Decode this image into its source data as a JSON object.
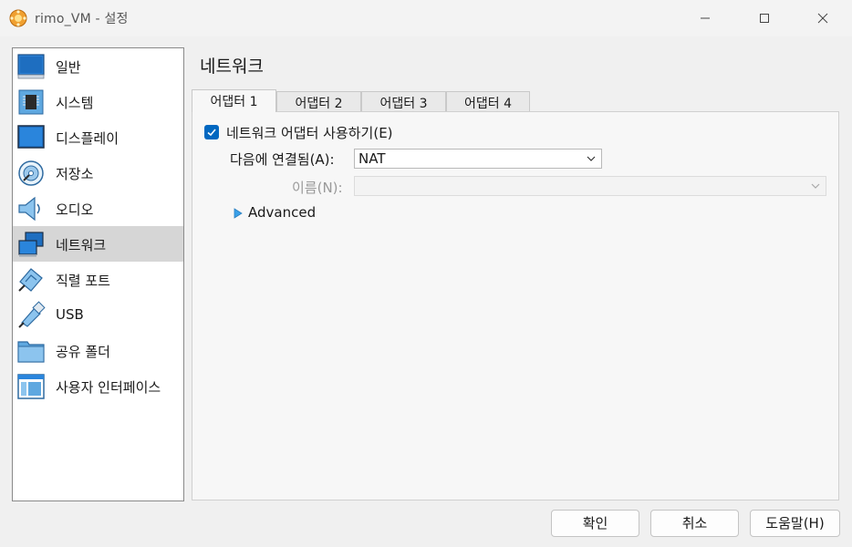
{
  "window": {
    "title": "rimo_VM - 설정"
  },
  "sidebar": {
    "items": [
      {
        "label": "일반",
        "icon": "general-icon"
      },
      {
        "label": "시스템",
        "icon": "system-chip-icon"
      },
      {
        "label": "디스플레이",
        "icon": "display-icon"
      },
      {
        "label": "저장소",
        "icon": "storage-disk-icon"
      },
      {
        "label": "오디오",
        "icon": "audio-speaker-icon"
      },
      {
        "label": "네트워크",
        "icon": "network-icon",
        "selected": true
      },
      {
        "label": "직렬 포트",
        "icon": "serial-port-icon"
      },
      {
        "label": "USB",
        "icon": "usb-icon"
      },
      {
        "label": "공유 폴더",
        "icon": "shared-folder-icon"
      },
      {
        "label": "사용자 인터페이스",
        "icon": "user-interface-icon"
      }
    ]
  },
  "page": {
    "title": "네트워크"
  },
  "tabs": [
    {
      "label": "어댑터 1",
      "active": true
    },
    {
      "label": "어댑터 2",
      "active": false
    },
    {
      "label": "어댑터 3",
      "active": false
    },
    {
      "label": "어댑터 4",
      "active": false
    }
  ],
  "adapter": {
    "enable_label": "네트워크 어댑터 사용하기(E)",
    "enabled": true,
    "attached_label": "다음에 연결됨(A):",
    "attached_value": "NAT",
    "name_label": "이름(N):",
    "name_value": "",
    "advanced_label": "Advanced"
  },
  "buttons": {
    "ok": "확인",
    "cancel": "취소",
    "help": "도움말(H)"
  },
  "colors": {
    "accent": "#0067c0",
    "selection": "#d6d6d6"
  }
}
